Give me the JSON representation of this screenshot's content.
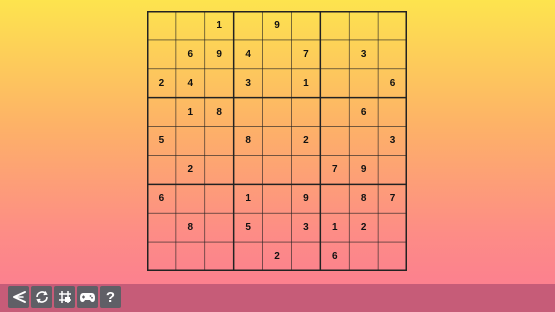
{
  "puzzle": {
    "grid": [
      [
        "",
        "",
        "1",
        "",
        "9",
        "",
        "",
        "",
        ""
      ],
      [
        "",
        "6",
        "9",
        "4",
        "",
        "7",
        "",
        "3",
        ""
      ],
      [
        "2",
        "4",
        "",
        "3",
        "",
        "1",
        "",
        "",
        "6"
      ],
      [
        "",
        "1",
        "8",
        "",
        "",
        "",
        "",
        "6",
        ""
      ],
      [
        "5",
        "",
        "",
        "8",
        "",
        "2",
        "",
        "",
        "3"
      ],
      [
        "",
        "2",
        "",
        "",
        "",
        "",
        "7",
        "9",
        ""
      ],
      [
        "6",
        "",
        "",
        "1",
        "",
        "9",
        "",
        "8",
        "7"
      ],
      [
        "",
        "8",
        "",
        "5",
        "",
        "3",
        "1",
        "2",
        ""
      ],
      [
        "",
        "",
        "",
        "",
        "2",
        "",
        "6",
        "",
        ""
      ]
    ]
  },
  "toolbar": {
    "buttons": [
      {
        "name": "back-icon",
        "glyph": "<"
      },
      {
        "name": "restart-icon",
        "glyph": "↻"
      },
      {
        "name": "grid-icon",
        "glyph": "#"
      },
      {
        "name": "gamepad-icon",
        "glyph": "🎮"
      },
      {
        "name": "help-icon",
        "glyph": "?"
      }
    ],
    "help_label": "?"
  },
  "colors": {
    "background_top": "#fde44e",
    "background_bottom": "#fb7a93",
    "toolbar": "#c65c78",
    "button": "#5f5f66",
    "grid_line": "#222222"
  }
}
